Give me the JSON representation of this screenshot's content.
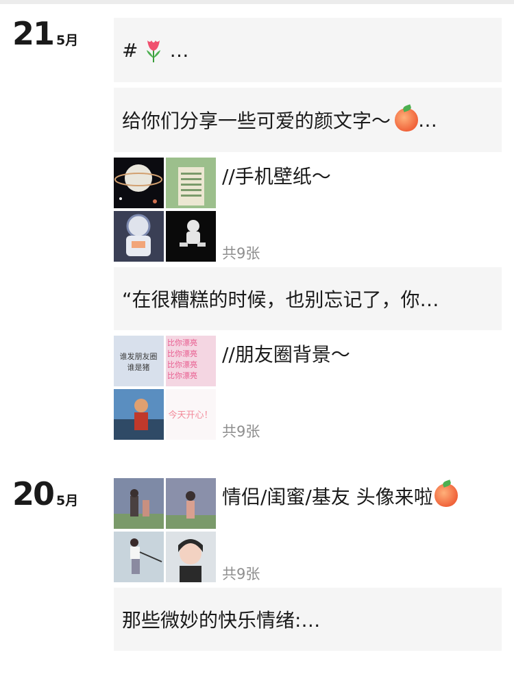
{
  "days": [
    {
      "day": "21",
      "month": "5月"
    },
    {
      "day": "20",
      "month": "5月"
    }
  ],
  "posts": [
    {
      "kind": "text",
      "hash": "#",
      "text": "…",
      "icon": "tulip-icon"
    },
    {
      "kind": "text",
      "text": "给你们分享一些可爱的颜文字～",
      "suffix": "…",
      "icon": "peach-icon"
    },
    {
      "kind": "photos",
      "title": "//手机壁纸～",
      "count": "共9张"
    },
    {
      "kind": "text",
      "text": "“在很糟糕的时候，也别忘记了，你…"
    },
    {
      "kind": "photos",
      "title": "//朋友圈背景～",
      "count": "共9张",
      "thumb_text_a": "谁发朋友圈\n谁是猪",
      "thumb_text_b": "比你漂亮",
      "thumb_text_c": "今天开心！"
    },
    {
      "kind": "photos",
      "title": "情侣/闺蜜/基友 头像来啦",
      "count": "共9张",
      "icon": "peach-icon"
    },
    {
      "kind": "text",
      "text": "那些微妙的快乐情绪:…"
    }
  ]
}
